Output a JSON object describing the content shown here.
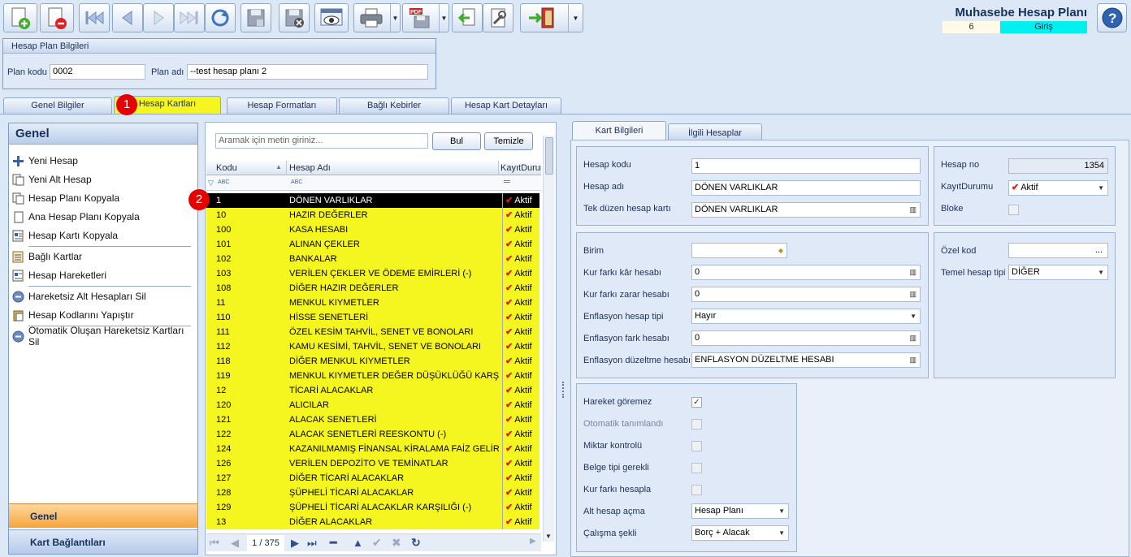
{
  "app": {
    "title": "Muhasebe Hesap Planı",
    "count": "6",
    "mode": "Giriş"
  },
  "toolbar": {
    "icons": [
      "new-doc-icon",
      "delete-doc-icon",
      "first-record-icon",
      "prev-record-icon",
      "next-record-icon",
      "last-record-icon",
      "refresh-icon",
      "save-icon",
      "save-cancel-icon",
      "preview-icon",
      "print-icon",
      "pdf-icon",
      "import-icon",
      "tools-icon",
      "exit-icon",
      "help-icon"
    ]
  },
  "plan": {
    "group_title": "Hesap Plan Bilgileri",
    "code_label": "Plan kodu",
    "code_value": "0002",
    "name_label": "Plan adı",
    "name_value": "--test hesap planı 2"
  },
  "tabs": [
    "Genel Bilgiler",
    "Hesap Kartları",
    "Hesap Formatları",
    "Bağlı Kebirler",
    "Hesap Kart Detayları"
  ],
  "markers": [
    "1",
    "2"
  ],
  "left": {
    "header": "Genel",
    "items": [
      "Yeni Hesap",
      "Yeni Alt Hesap",
      "Hesap Planı Kopyala",
      "Ana Hesap Planı Kopyala",
      "Hesap Kartı Kopyala",
      "Bağlı Kartlar",
      "Hesap Hareketleri",
      "Hareketsiz Alt Hesapları Sil",
      "Hesap Kodlarını Yapıştır",
      "Otomatik Oluşan Hareketsiz Kartları Sil"
    ],
    "footer_active": "Genel",
    "footer": "Kart Bağlantıları"
  },
  "search": {
    "placeholder": "Aramak için metin giriniz...",
    "find": "Bul",
    "clear": "Temizle"
  },
  "grid": {
    "columns": [
      "Kodu",
      "Hesap Adı",
      "KayıtDurum"
    ],
    "filter_tag": "ABC",
    "rows": [
      {
        "code": "1",
        "name": "DÖNEN VARLIKLAR",
        "status": "Aktif"
      },
      {
        "code": "10",
        "name": "HAZIR DEĞERLER",
        "status": "Aktif"
      },
      {
        "code": "100",
        "name": "KASA HESABI",
        "status": "Aktif"
      },
      {
        "code": "101",
        "name": "ALINAN ÇEKLER",
        "status": "Aktif"
      },
      {
        "code": "102",
        "name": "BANKALAR",
        "status": "Aktif"
      },
      {
        "code": "103",
        "name": "VERİLEN ÇEKLER VE ÖDEME EMİRLERİ (-)",
        "status": "Aktif"
      },
      {
        "code": "108",
        "name": "DİĞER HAZIR DEĞERLER",
        "status": "Aktif"
      },
      {
        "code": "11",
        "name": "MENKUL KIYMETLER",
        "status": "Aktif"
      },
      {
        "code": "110",
        "name": "HİSSE SENETLERİ",
        "status": "Aktif"
      },
      {
        "code": "111",
        "name": "ÖZEL KESİM TAHVİL, SENET VE BONOLARI",
        "status": "Aktif"
      },
      {
        "code": "112",
        "name": "KAMU KESİMİ, TAHVİL, SENET VE BONOLARI",
        "status": "Aktif"
      },
      {
        "code": "118",
        "name": "DİĞER MENKUL KIYMETLER",
        "status": "Aktif"
      },
      {
        "code": "119",
        "name": "MENKUL KIYMETLER DEĞER DÜŞÜKLÜĞÜ KARŞILIĞI (",
        "status": "Aktif"
      },
      {
        "code": "12",
        "name": "TİCARİ ALACAKLAR",
        "status": "Aktif"
      },
      {
        "code": "120",
        "name": "ALICILAR",
        "status": "Aktif"
      },
      {
        "code": "121",
        "name": "ALACAK SENETLERİ",
        "status": "Aktif"
      },
      {
        "code": "122",
        "name": "ALACAK SENETLERİ REESKONTU (-)",
        "status": "Aktif"
      },
      {
        "code": "124",
        "name": "KAZANILMAMIŞ FİNANSAL KİRALAMA FAİZ GELİRLER",
        "status": "Aktif"
      },
      {
        "code": "126",
        "name": "VERİLEN DEPOZİTO VE TEMİNATLAR",
        "status": "Aktif"
      },
      {
        "code": "127",
        "name": "DİĞER TİCARİ ALACAKLAR",
        "status": "Aktif"
      },
      {
        "code": "128",
        "name": "ŞÜPHELİ TİCARİ ALACAKLAR",
        "status": "Aktif"
      },
      {
        "code": "129",
        "name": "ŞÜPHELİ TİCARİ ALACAKLAR KARŞILIĞI (-)",
        "status": "Aktif"
      },
      {
        "code": "13",
        "name": "DİĞER ALACAKLAR",
        "status": "Aktif"
      }
    ],
    "pager": "1 / 375"
  },
  "detail": {
    "tabs": [
      "Kart Bilgileri",
      "İlgili Hesaplar"
    ],
    "hesap_kodu": {
      "label": "Hesap kodu",
      "value": "1"
    },
    "hesap_adi": {
      "label": "Hesap adı",
      "value": "DÖNEN VARLIKLAR"
    },
    "tek_duzen": {
      "label": "Tek düzen hesap kartı",
      "value": "DÖNEN VARLIKLAR"
    },
    "hesap_no": {
      "label": "Hesap no",
      "value": "1354"
    },
    "kayit_durumu": {
      "label": "KayıtDurumu",
      "value": "Aktif"
    },
    "bloke": {
      "label": "Bloke"
    },
    "birim": {
      "label": "Birim",
      "value": ""
    },
    "kur_kar": {
      "label": "Kur farkı kâr hesabı",
      "value": "0"
    },
    "kur_zarar": {
      "label": "Kur farkı zarar hesabı",
      "value": "0"
    },
    "enf_tipi": {
      "label": "Enflasyon hesap tipi",
      "value": "Hayır"
    },
    "enf_fark": {
      "label": "Enflasyon fark hesabı",
      "value": "0"
    },
    "enf_duzeltme": {
      "label": "Enflasyon düzeltme hesabı",
      "value": "ENFLASYON DÜZELTME HESABI"
    },
    "ozel_kod": {
      "label": "Özel kod",
      "value": "..."
    },
    "temel_tip": {
      "label": "Temel hesap tipi",
      "value": "DİĞER"
    },
    "hareket": {
      "label": "Hareket göremez"
    },
    "otomatik": {
      "label": "Otomatik tanımlandı"
    },
    "miktar": {
      "label": "Miktar kontrolü"
    },
    "belge": {
      "label": "Belge tipi gerekli"
    },
    "kur_hesapla": {
      "label": "Kur farkı hesapla"
    },
    "alt_hesap": {
      "label": "Alt hesap açma",
      "value": "Hesap Planı"
    },
    "calisma": {
      "label": "Çalışma şekli",
      "value": "Borç + Alacak"
    }
  },
  "colors": {
    "highlight": "#f5f520",
    "marker": "#e60000",
    "mode_bg": "#00f0f0"
  }
}
